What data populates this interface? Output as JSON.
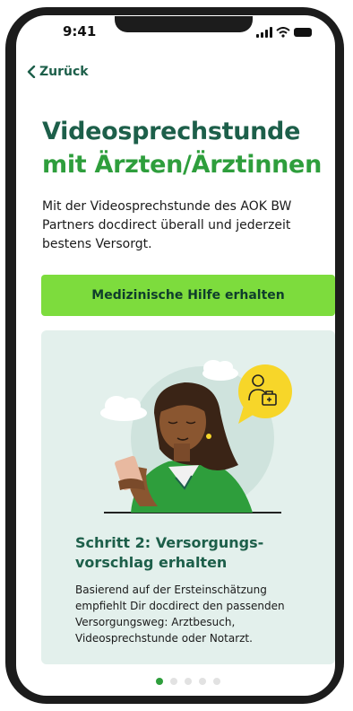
{
  "status_bar": {
    "time": "9:41"
  },
  "nav": {
    "back_label": "Zurück"
  },
  "header": {
    "title_line1": "Videosprechstunde",
    "title_line2": "mit Ärzten/Ärztinnen"
  },
  "intro": {
    "line1": "Mit der Videosprechstunde des AOK BW",
    "line2": "Partners docdirect überall und jederzeit",
    "line3": "bestens Versorgt."
  },
  "cta": {
    "label": "Medizinische Hilfe erhalten"
  },
  "step_card": {
    "title_line1": "Schritt 2: Versorgungs-",
    "title_line2": "vorschlag erhalten",
    "text_line1": "Basierend auf der Ersteinschätzung",
    "text_line2": "empfiehlt Dir docdirect den passenden",
    "text_line3": "Versorgungsweg: Arztbesuch,",
    "text_line4": "Videosprechstunde oder Notarzt."
  },
  "pagination": {
    "current": 1,
    "total": 5
  },
  "colors": {
    "primary_dark_green": "#1d5f4a",
    "accent_green": "#2e9e3c",
    "cta_lime": "#7ddc3d",
    "card_background": "#e3f0ec",
    "badge_yellow": "#f7d629"
  },
  "icons": [
    "back-chevron-icon",
    "signal-icon",
    "wifi-icon",
    "battery-icon",
    "doctor-medical-case-icon"
  ]
}
